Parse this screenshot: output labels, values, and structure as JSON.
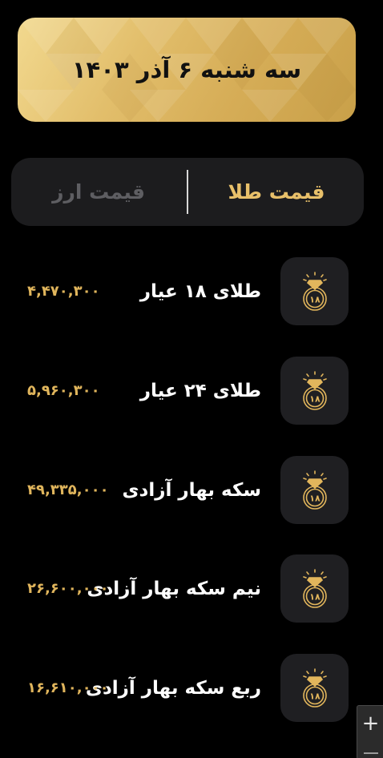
{
  "header": {
    "date": "سه شنبه ۶ آذر ۱۴۰۳"
  },
  "tabs": {
    "gold_label": "قیمت طلا",
    "currency_label": "قیمت ارز",
    "active": "gold"
  },
  "items": [
    {
      "name": "طلای ۱۸ عیار",
      "price": "۴,۴۷۰,۳۰۰",
      "icon": "gold-ring-18-icon"
    },
    {
      "name": "طلای ۲۴ عیار",
      "price": "۵,۹۶۰,۳۰۰",
      "icon": "gold-ring-18-icon"
    },
    {
      "name": "سکه بهار آزادی",
      "price": "۴۹,۳۳۵,۰۰۰",
      "icon": "gold-ring-18-icon"
    },
    {
      "name": "نیم سکه بهار آزادی",
      "price": "۲۶,۶۰۰,۰۰۰",
      "icon": "gold-ring-18-icon"
    },
    {
      "name": "ربع سکه بهار آزادی",
      "price": "۱۶,۶۱۰,۰۰۰",
      "icon": "gold-ring-18-icon"
    }
  ],
  "ring_badge_text": "۱۸",
  "zoom": {
    "plus_label": "+"
  },
  "colors": {
    "background": "#000000",
    "gold_accent": "#e8c06a",
    "price_color": "#e0b55c",
    "card_gold": "#d6ad57",
    "icon_box": "#1f1f22",
    "tab_bar": "#1c1c1e"
  }
}
